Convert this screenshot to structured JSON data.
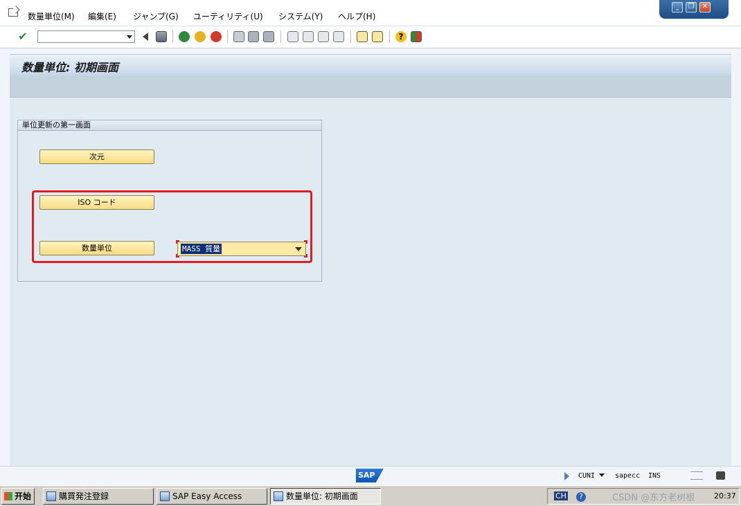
{
  "menubar": {
    "items": [
      "数量単位(M)",
      "編集(E)",
      "ジャンプ(G)",
      "ユーティリティ(U)",
      "システム(Y)",
      "ヘルプ(H)"
    ]
  },
  "toolbar": {
    "command_field_value": ""
  },
  "title": "数量単位: 初期画面",
  "group": {
    "title": "単位更新の第一画面",
    "buttons": {
      "dimension": "次元",
      "iso_code": "ISO コード",
      "unit_of_measure": "数量単位"
    },
    "dimension_dropdown": {
      "value": "MASS 質量"
    }
  },
  "statusbar": {
    "sap_logo": "SAP",
    "transaction": "CUNI",
    "server": "sapecc",
    "mode": "INS"
  },
  "taskbar": {
    "start_label": "开始",
    "tasks": [
      "購買発注登録",
      "SAP Easy Access",
      "数量単位: 初期画面"
    ],
    "tray": {
      "lang": "CH",
      "watermark": "CSDN @东方老树根",
      "clock": "20:37"
    }
  },
  "colors": {
    "highlight_box": "#e01b24",
    "button_yellow": "#f6dc84",
    "content_bg": "#dfeaf1"
  }
}
